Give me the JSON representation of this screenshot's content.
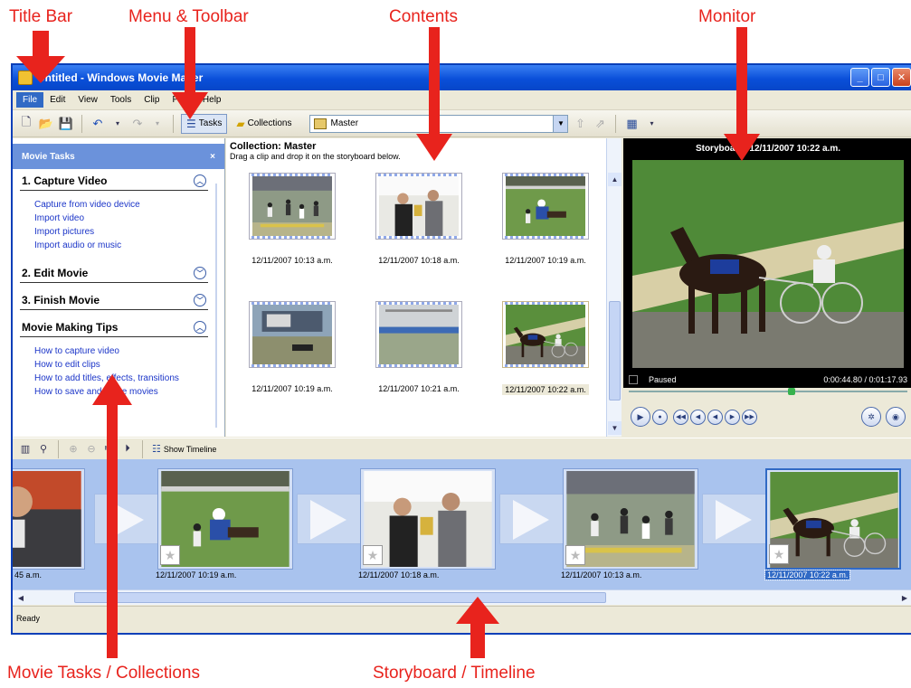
{
  "annotations": {
    "title_bar": "Title Bar",
    "menu_toolbar": "Menu & Toolbar",
    "contents": "Contents",
    "monitor": "Monitor",
    "movie_tasks": "Movie Tasks / Collections",
    "storyboard": "Storyboard / Timeline"
  },
  "window": {
    "title": "Untitled - Windows Movie Maker",
    "accent": "#0a4fd9"
  },
  "menu": [
    "File",
    "Edit",
    "View",
    "Tools",
    "Clip",
    "Play",
    "Help"
  ],
  "toolbar": {
    "tasks_label": "Tasks",
    "collections_label": "Collections",
    "collection_select": "Master"
  },
  "tasks": {
    "header": "Movie Tasks",
    "close": "×",
    "sections": [
      {
        "title": "1. Capture Video",
        "links": [
          "Capture from video device",
          "Import video",
          "Import pictures",
          "Import audio or music"
        ]
      },
      {
        "title": "2. Edit Movie",
        "links": []
      },
      {
        "title": "3. Finish Movie",
        "links": []
      },
      {
        "title": "Movie Making Tips",
        "links": [
          "How to capture video",
          "How to edit clips",
          "How to add titles, effects, transitions",
          "How to save and share movies"
        ]
      }
    ]
  },
  "collection": {
    "title": "Collection: Master",
    "subtitle": "Drag a clip and drop it on the storyboard below.",
    "clips": [
      {
        "label": "12/11/2007 10:13 a.m.",
        "scene": "crowd"
      },
      {
        "label": "12/11/2007 10:18 a.m.",
        "scene": "trophy"
      },
      {
        "label": "12/11/2007 10:19 a.m.",
        "scene": "parade"
      },
      {
        "label": "12/11/2007 10:19 a.m.",
        "scene": "track"
      },
      {
        "label": "12/11/2007 10:21 a.m.",
        "scene": "grandstand"
      },
      {
        "label": "12/11/2007 10:22 a.m.",
        "scene": "horse"
      }
    ]
  },
  "monitor": {
    "title": "Storyboard: 12/11/2007 10:22 a.m.",
    "status": "Paused",
    "time": "0:00:44.80 / 0:01:17.93"
  },
  "storyboard": {
    "show_timeline": "Show Timeline",
    "clips": [
      {
        "label": "45 a.m.",
        "scene": "man"
      },
      {
        "label": "12/11/2007 10:19 a.m.",
        "scene": "parade"
      },
      {
        "label": "12/11/2007 10:18 a.m.",
        "scene": "trophy"
      },
      {
        "label": "12/11/2007 10:13 a.m.",
        "scene": "crowd"
      },
      {
        "label": "12/11/2007 10:22 a.m.",
        "scene": "horse",
        "selected": true
      }
    ]
  },
  "statusbar": {
    "text": "Ready"
  }
}
